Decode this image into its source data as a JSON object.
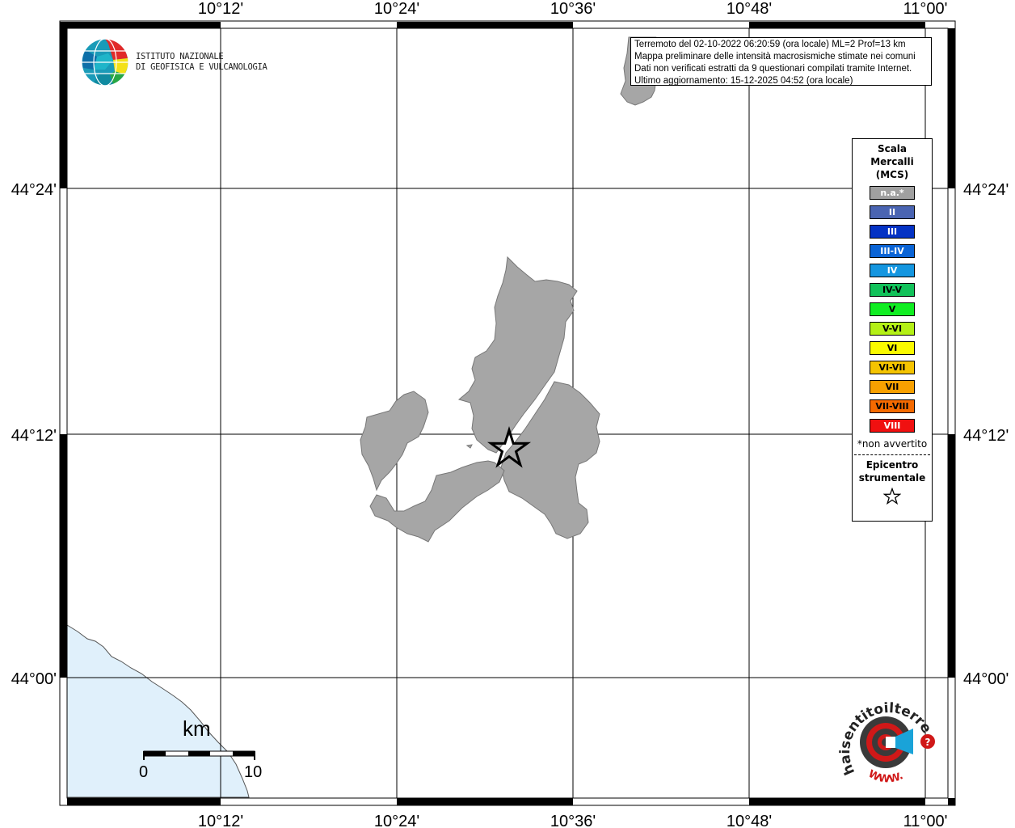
{
  "map": {
    "lon_labels": [
      "10°12'",
      "10°24'",
      "10°36'",
      "10°48'",
      "11°00'"
    ],
    "lat_labels": [
      "44°24'",
      "44°12'",
      "44°00'"
    ]
  },
  "info": {
    "line1": "Terremoto del 02-10-2022 06:20:59 (ora locale) ML=2 Prof=13 km",
    "line2": "Mappa preliminare delle intensità macrosismiche stimate nei comuni",
    "line3": "Dati non verificati estratti da 9 questionari compilati tramite Internet.",
    "line4": "Ultimo aggiornamento: 15-12-2025 04:52 (ora locale)"
  },
  "legend": {
    "title1": "Scala",
    "title2": "Mercalli",
    "title3": "(MCS)",
    "items": [
      {
        "label": "n.a.*",
        "color": "#a0a0a0",
        "text_color": "#ffffff"
      },
      {
        "label": "II",
        "color": "#4a64b2",
        "text_color": "#ffffff"
      },
      {
        "label": "III",
        "color": "#0432c4",
        "text_color": "#ffffff"
      },
      {
        "label": "III-IV",
        "color": "#0a64d6",
        "text_color": "#ffffff"
      },
      {
        "label": "IV",
        "color": "#1496e0",
        "text_color": "#ffffff"
      },
      {
        "label": "IV-V",
        "color": "#12c25a",
        "text_color": "#000000"
      },
      {
        "label": "V",
        "color": "#10ee22",
        "text_color": "#000000"
      },
      {
        "label": "V-VI",
        "color": "#b4f016",
        "text_color": "#000000"
      },
      {
        "label": "VI",
        "color": "#fafa00",
        "text_color": "#000000"
      },
      {
        "label": "VI-VII",
        "color": "#f5c400",
        "text_color": "#000000"
      },
      {
        "label": "VII",
        "color": "#f7a000",
        "text_color": "#000000"
      },
      {
        "label": "VII-VIII",
        "color": "#f56a00",
        "text_color": "#000000"
      },
      {
        "label": "VIII",
        "color": "#f01010",
        "text_color": "#ffffff"
      }
    ],
    "note": "*non avvertito",
    "epi1": "Epicentro",
    "epi2": "strumentale"
  },
  "logos": {
    "ingv_line1": "ISTITUTO NAZIONALE",
    "ingv_line2": "DI GEOFISICA E VULCANOLOGIA",
    "hsit_text": "haisentitoilterremoto.it",
    "hsit_www": "WWW."
  },
  "scale_bar": {
    "unit": "km",
    "min_label": "0",
    "max_label": "10"
  },
  "colors": {
    "region_fill": "#a6a6a6",
    "sea_fill": "#e0f0fb",
    "frame": "#000000"
  },
  "icons": [
    "epicenter-star-icon",
    "ingv-globe-logo",
    "haisentito-logo"
  ]
}
